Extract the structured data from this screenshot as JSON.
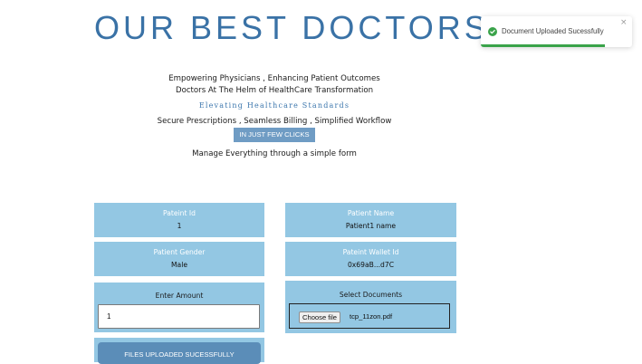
{
  "header": {
    "title": "OUR BEST DOCTORS"
  },
  "intro": {
    "line1": "Empowering Physicians , Enhancing Patient Outcomes",
    "line2": "Doctors At The Helm of HealthCare Transformation",
    "line3": "Elevating Healthcare Standards",
    "line4": "Secure Prescriptions , Seamless Billing , Simplified Workflow",
    "clicks_button": "IN JUST FEW CLICKS",
    "line5": "Manage Everything through a simple form"
  },
  "form": {
    "patient_id": {
      "label": "Pateint Id",
      "value": "1"
    },
    "patient_name": {
      "label": "Patient Name",
      "value": "Patient1 name"
    },
    "patient_gender": {
      "label": "Patient Gender",
      "value": "Male"
    },
    "patient_wallet": {
      "label": "Pateint Wallet Id",
      "value": "0x69aB...d7C"
    },
    "amount": {
      "label": "Enter Amount",
      "value": "1"
    },
    "documents": {
      "label": "Select Documents",
      "choose_label": "Choose file",
      "file_name": "tcp_11zon.pdf"
    },
    "submit_label": "FILES UPLOADED SUCESSFULLY"
  },
  "toast": {
    "message": "Document Uploaded Sucessfully",
    "close_symbol": "×",
    "icon": "check-circle-icon",
    "progress": 0.82
  },
  "colors": {
    "accent": "#3a72a6",
    "card": "#93c7e3",
    "button": "#6f9cc4",
    "success": "#3aa34a"
  }
}
